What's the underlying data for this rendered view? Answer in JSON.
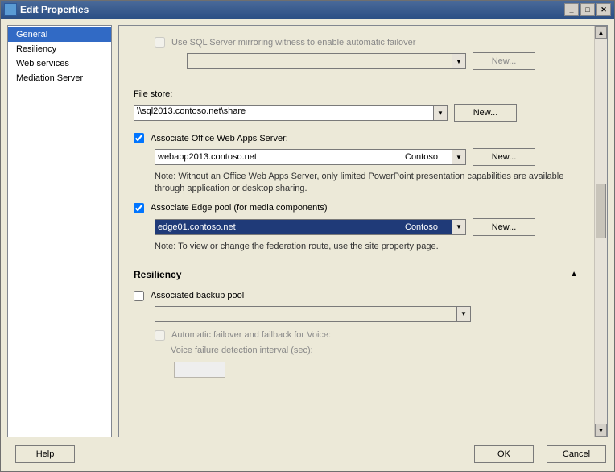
{
  "title": "Edit Properties",
  "nav": {
    "items": [
      {
        "label": "General",
        "selected": true
      },
      {
        "label": "Resiliency"
      },
      {
        "label": "Web services"
      },
      {
        "label": "Mediation Server"
      }
    ]
  },
  "mirror": {
    "label": "Use SQL Server mirroring witness to enable automatic failover",
    "checked": false,
    "enabled": false,
    "new": "New..."
  },
  "filestore": {
    "label": "File store:",
    "value": "\\\\sql2013.contoso.net\\share",
    "new": "New..."
  },
  "owa": {
    "chk_label": "Associate Office Web Apps Server:",
    "checked": true,
    "value": "webapp2013.contoso.net",
    "right": "Contoso",
    "new": "New...",
    "note": "Note: Without an Office Web Apps Server, only limited PowerPoint presentation capabilities are available through application or desktop sharing."
  },
  "edge": {
    "chk_label": "Associate Edge pool (for media components)",
    "checked": true,
    "value": "edge01.contoso.net",
    "right": "Contoso",
    "new": "New...",
    "note": "Note: To view or change the federation route, use the site property page."
  },
  "resiliency": {
    "header": "Resiliency",
    "backup": {
      "label": "Associated backup pool",
      "checked": false
    },
    "failover": {
      "label": "Automatic failover and failback for Voice:",
      "checked": false,
      "enabled": false,
      "interval_label": "Voice failure detection interval (sec):",
      "interval_value": ""
    }
  },
  "footer": {
    "help": "Help",
    "ok": "OK",
    "cancel": "Cancel"
  }
}
